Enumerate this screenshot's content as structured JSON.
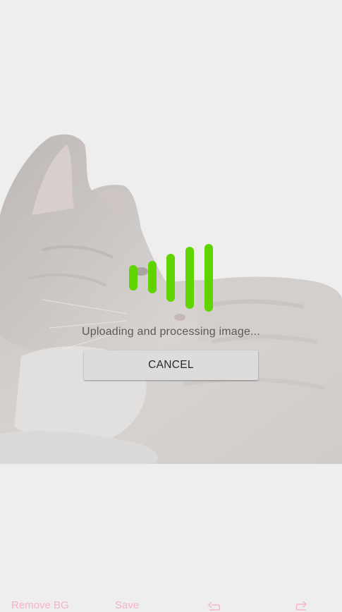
{
  "dialog": {
    "status_text": "Uploading and processing image...",
    "cancel_label": "CANCEL"
  },
  "loader": {
    "color": "#5fd400",
    "icon": "equalizer-bars-icon"
  },
  "toolbar": {
    "remove_bg_label": "Remove BG",
    "save_label": "Save",
    "undo_icon": "undo-arrow-icon",
    "redo_icon": "redo-arrow-icon",
    "label_color": "#f7b3c6"
  }
}
